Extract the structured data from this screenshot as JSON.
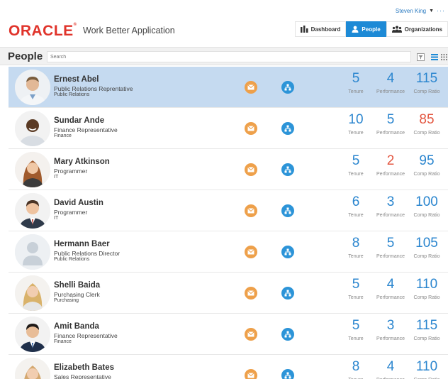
{
  "header": {
    "user_name": "Steven King",
    "logo_text": "ORACLE",
    "app_title": "Work Better Application",
    "nav": {
      "dashboard": "Dashboard",
      "people": "People",
      "organizations": "Organizations"
    }
  },
  "toolbar": {
    "title": "People",
    "search_placeholder": "Search"
  },
  "metric_labels": {
    "tenure": "Tenure",
    "performance": "Performance",
    "comp_ratio": "Comp Ratio"
  },
  "colors": {
    "brand_red": "#e0332a",
    "accent_blue": "#1d8ad6",
    "selected_row": "#c5daf0",
    "metric_blue": "#2b86cf",
    "metric_red": "#e35640",
    "mail_orange": "#eea04a"
  },
  "people": [
    {
      "name": "Ernest Abel",
      "title": "Public Relations Reprentative",
      "department": "Public Relations",
      "tenure": "5",
      "performance": "4",
      "comp_ratio": "115",
      "selected": true
    },
    {
      "name": "Sundar Ande",
      "title": "Finance Representative",
      "department": "Finance",
      "tenure": "10",
      "performance": "5",
      "comp_ratio": "85",
      "selected": false
    },
    {
      "name": "Mary Atkinson",
      "title": "Programmer",
      "department": "IT",
      "tenure": "5",
      "performance": "2",
      "comp_ratio": "95",
      "selected": false
    },
    {
      "name": "David Austin",
      "title": "Programmer",
      "department": "IT",
      "tenure": "6",
      "performance": "3",
      "comp_ratio": "100",
      "selected": false
    },
    {
      "name": "Hermann Baer",
      "title": "Public Relations Director",
      "department": "Public Relations",
      "tenure": "8",
      "performance": "5",
      "comp_ratio": "105",
      "selected": false
    },
    {
      "name": "Shelli Baida",
      "title": "Purchasing Clerk",
      "department": "Purchasing",
      "tenure": "5",
      "performance": "4",
      "comp_ratio": "110",
      "selected": false
    },
    {
      "name": "Amit Banda",
      "title": "Finance Representative",
      "department": "Finance",
      "tenure": "5",
      "performance": "3",
      "comp_ratio": "115",
      "selected": false
    },
    {
      "name": "Elizabeth Bates",
      "title": "Sales Representative",
      "department": "",
      "tenure": "8",
      "performance": "4",
      "comp_ratio": "110",
      "selected": false
    }
  ]
}
